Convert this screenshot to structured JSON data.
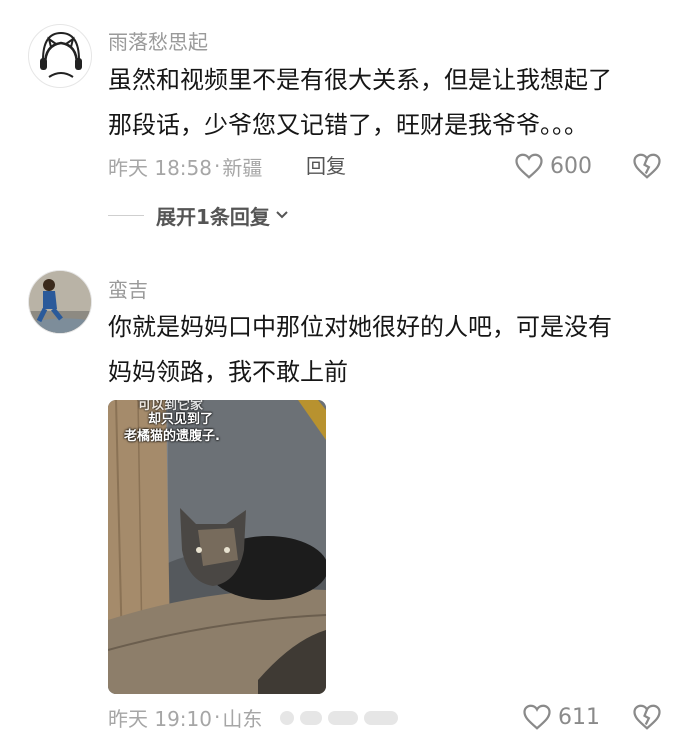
{
  "comments": [
    {
      "username": "雨落愁思起",
      "text_line1": "虽然和视频里不是有很大关系，但是让我想起了",
      "text_line2": "那段话，少爷您又记错了，旺财是我爷爷。。。",
      "time": "昨天 18:58",
      "sep": "·",
      "location": "新疆",
      "reply_label": "回复",
      "likes": "600",
      "expand_label": "展开1条回复"
    },
    {
      "username": "蛮吉",
      "text_line1": "你就是妈妈口中那位对她很好的人吧，可是没有",
      "text_line2": "妈妈领路，我不敢上前",
      "image_caption": [
        "却只见到了",
        "老橘猫的遗腹子."
      ],
      "image_caption_partial": "可以到它家",
      "time": "昨天 19:10",
      "sep": "·",
      "location": "山东",
      "likes": "611"
    }
  ],
  "colors": {
    "meta_gray": "#a6a6a6",
    "username_gray": "#9a9a9a",
    "text": "#161616"
  }
}
